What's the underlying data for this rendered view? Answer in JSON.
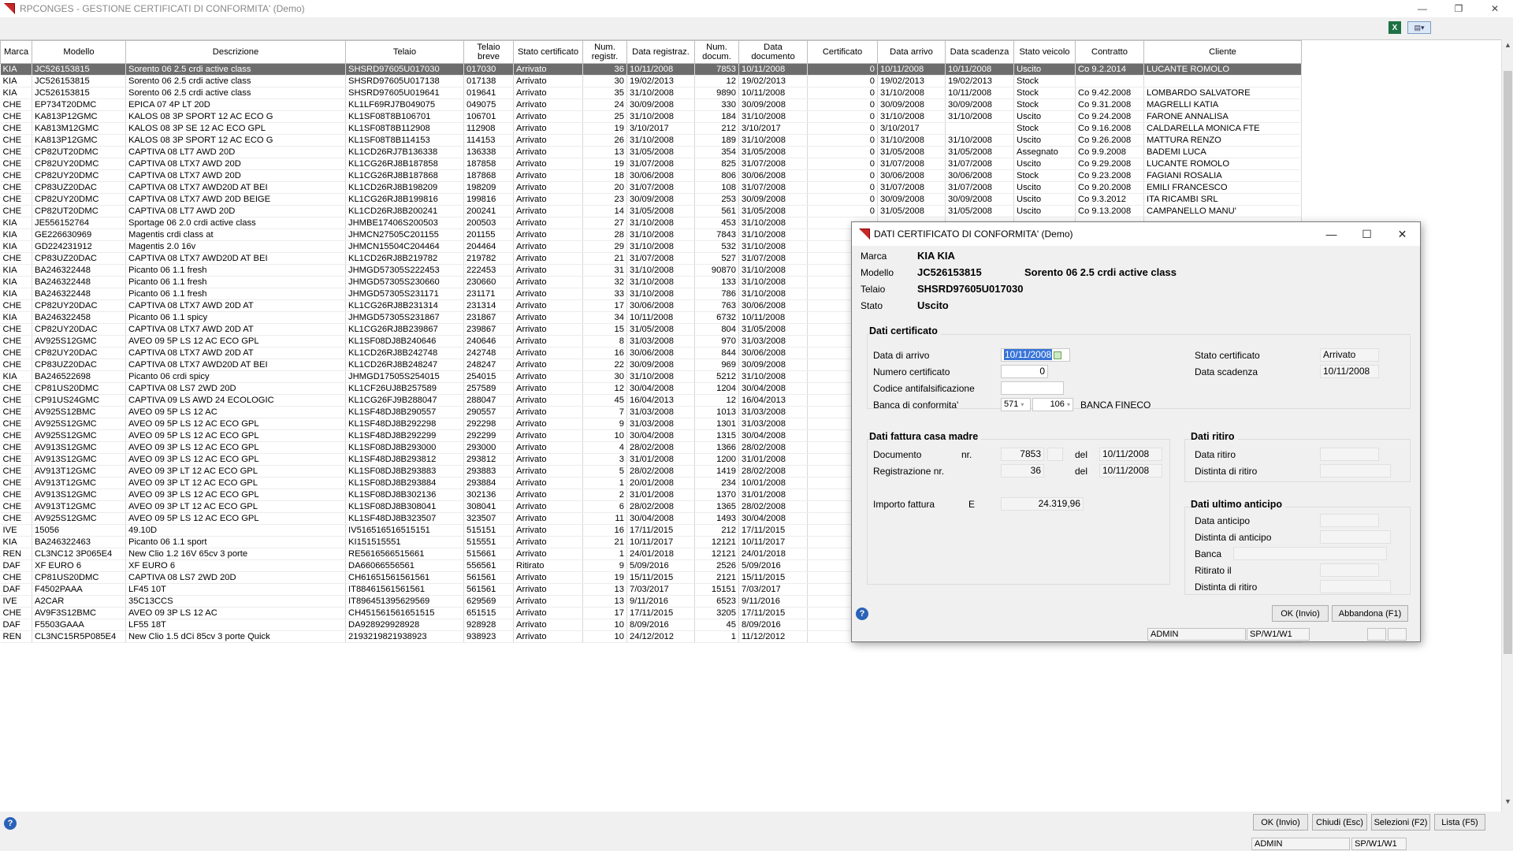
{
  "app": {
    "title": "RPCONGES - GESTIONE CERTIFICATI DI CONFORMITA'  (Demo)"
  },
  "window_controls": {
    "minimize": "—",
    "maximize": "❐",
    "close": "✕"
  },
  "toolbar": {
    "excel_icon": "X",
    "menu_icon": "▤▾"
  },
  "grid": {
    "columns": [
      "Marca",
      "Modello",
      "Descrizione",
      "Telaio",
      "Telaio breve",
      "Stato certificato",
      "Num. registr.",
      "Data registraz.",
      "Num. docum.",
      "Data documento",
      "Certificato",
      "Data arrivo",
      "Data scadenza",
      "Stato veicolo",
      "Contratto",
      "Cliente"
    ],
    "rows": [
      [
        "KIA",
        "JC526153815",
        "Sorento 06 2.5 crdi active class",
        "SHSRD97605U017030",
        "017030",
        "Arrivato",
        "36",
        "10/11/2008",
        "7853",
        "10/11/2008",
        "0",
        "10/11/2008",
        "10/11/2008",
        "Uscito",
        "Co 9.2.2014",
        "LUCANTE ROMOLO"
      ],
      [
        "KIA",
        "JC526153815",
        "Sorento 06 2.5 crdi active class",
        "SHSRD97605U017138",
        "017138",
        "Arrivato",
        "30",
        "19/02/2013",
        "12",
        "19/02/2013",
        "0",
        "19/02/2013",
        "19/02/2013",
        "Stock",
        "",
        ""
      ],
      [
        "KIA",
        "JC526153815",
        "Sorento 06 2.5 crdi active class",
        "SHSRD97605U019641",
        "019641",
        "Arrivato",
        "35",
        "31/10/2008",
        "9890",
        "10/11/2008",
        "0",
        "31/10/2008",
        "10/11/2008",
        "Stock",
        "Co 9.42.2008",
        "LOMBARDO SALVATORE"
      ],
      [
        "CHE",
        "EP734T20DMC",
        "EPICA 07 4P LT 20D",
        "KL1LF69RJ7B049075",
        "049075",
        "Arrivato",
        "24",
        "30/09/2008",
        "330",
        "30/09/2008",
        "0",
        "30/09/2008",
        "30/09/2008",
        "Stock",
        "Co 9.31.2008",
        "MAGRELLI KATIA"
      ],
      [
        "CHE",
        "KA813P12GMC",
        "KALOS 08 3P SPORT 12 AC ECO G",
        "KL1SF08T8B106701",
        "106701",
        "Arrivato",
        "25",
        "31/10/2008",
        "184",
        "31/10/2008",
        "0",
        "31/10/2008",
        "31/10/2008",
        "Uscito",
        "Co 9.24.2008",
        "FARONE ANNALISA"
      ],
      [
        "CHE",
        "KA813M12GMC",
        "KALOS 08 3P SE 12 AC ECO GPL",
        "KL1SF08T8B112908",
        "112908",
        "Arrivato",
        "19",
        "3/10/2017",
        "212",
        "3/10/2017",
        "0",
        "3/10/2017",
        "",
        "Stock",
        "Co 9.16.2008",
        "CALDARELLA MONICA FTE"
      ],
      [
        "CHE",
        "KA813P12GMC",
        "KALOS 08 3P SPORT 12 AC ECO G",
        "KL1SF08T8B114153",
        "114153",
        "Arrivato",
        "26",
        "31/10/2008",
        "189",
        "31/10/2008",
        "0",
        "31/10/2008",
        "31/10/2008",
        "Uscito",
        "Co 9.26.2008",
        "MATTURA RENZO"
      ],
      [
        "CHE",
        "CP82UT20DMC",
        "CAPTIVA 08 LT7 AWD 20D",
        "KL1CD26RJ7B136338",
        "136338",
        "Arrivato",
        "13",
        "31/05/2008",
        "354",
        "31/05/2008",
        "0",
        "31/05/2008",
        "31/05/2008",
        "Assegnato",
        "Co 9.9.2008",
        "BADEMI LUCA"
      ],
      [
        "CHE",
        "CP82UY20DMC",
        "CAPTIVA 08 LTX7 AWD 20D",
        "KL1CG26RJ8B187858",
        "187858",
        "Arrivato",
        "19",
        "31/07/2008",
        "825",
        "31/07/2008",
        "0",
        "31/07/2008",
        "31/07/2008",
        "Uscito",
        "Co 9.29.2008",
        "LUCANTE ROMOLO"
      ],
      [
        "CHE",
        "CP82UY20DMC",
        "CAPTIVA 08 LTX7 AWD 20D",
        "KL1CG26RJ8B187868",
        "187868",
        "Arrivato",
        "18",
        "30/06/2008",
        "806",
        "30/06/2008",
        "0",
        "30/06/2008",
        "30/06/2008",
        "Stock",
        "Co 9.23.2008",
        "FAGIANI ROSALIA"
      ],
      [
        "CHE",
        "CP83UZ20DAC",
        "CAPTIVA 08 LTX7 AWD20D AT BEI",
        "KL1CD26RJ8B198209",
        "198209",
        "Arrivato",
        "20",
        "31/07/2008",
        "108",
        "31/07/2008",
        "0",
        "31/07/2008",
        "31/07/2008",
        "Uscito",
        "Co 9.20.2008",
        "EMILI FRANCESCO"
      ],
      [
        "CHE",
        "CP82UY20DMC",
        "CAPTIVA 08 LTX7 AWD 20D BEIGE",
        "KL1CG26RJ8B199816",
        "199816",
        "Arrivato",
        "23",
        "30/09/2008",
        "253",
        "30/09/2008",
        "0",
        "30/09/2008",
        "30/09/2008",
        "Uscito",
        "Co 9.3.2012",
        "ITA RICAMBI SRL"
      ],
      [
        "CHE",
        "CP82UT20DMC",
        "CAPTIVA 08 LT7 AWD 20D",
        "KL1CD26RJ8B200241",
        "200241",
        "Arrivato",
        "14",
        "31/05/2008",
        "561",
        "31/05/2008",
        "0",
        "31/05/2008",
        "31/05/2008",
        "Uscito",
        "Co 9.13.2008",
        "CAMPANELLO MANU'"
      ],
      [
        "KIA",
        "JE556152764",
        "Sportage 06 2.0 crdi active class",
        "JHMBE17406S200503",
        "200503",
        "Arrivato",
        "27",
        "31/10/2008",
        "453",
        "31/10/2008",
        "",
        "",
        "",
        "",
        "",
        ""
      ],
      [
        "KIA",
        "GE226630969",
        "Magentis crdi class at",
        "JHMCN27505C201155",
        "201155",
        "Arrivato",
        "28",
        "31/10/2008",
        "7843",
        "31/10/2008",
        "",
        "",
        "",
        "",
        "",
        ""
      ],
      [
        "KIA",
        "GD224231912",
        "Magentis 2.0 16v",
        "JHMCN15504C204464",
        "204464",
        "Arrivato",
        "29",
        "31/10/2008",
        "532",
        "31/10/2008",
        "",
        "",
        "",
        "",
        "",
        ""
      ],
      [
        "CHE",
        "CP83UZ20DAC",
        "CAPTIVA 08 LTX7 AWD20D AT BEI",
        "KL1CD26RJ8B219782",
        "219782",
        "Arrivato",
        "21",
        "31/07/2008",
        "527",
        "31/07/2008",
        "",
        "",
        "",
        "",
        "",
        ""
      ],
      [
        "KIA",
        "BA246322448",
        "Picanto 06 1.1 fresh",
        "JHMGD57305S222453",
        "222453",
        "Arrivato",
        "31",
        "31/10/2008",
        "90870",
        "31/10/2008",
        "",
        "",
        "",
        "",
        "",
        ""
      ],
      [
        "KIA",
        "BA246322448",
        "Picanto 06 1.1 fresh",
        "JHMGD57305S230660",
        "230660",
        "Arrivato",
        "32",
        "31/10/2008",
        "133",
        "31/10/2008",
        "",
        "",
        "",
        "",
        "",
        ""
      ],
      [
        "KIA",
        "BA246322448",
        "Picanto 06 1.1 fresh",
        "JHMGD57305S231171",
        "231171",
        "Arrivato",
        "33",
        "31/10/2008",
        "786",
        "31/10/2008",
        "",
        "",
        "",
        "",
        "",
        ""
      ],
      [
        "CHE",
        "CP82UY20DAC",
        "CAPTIVA 08 LTX7 AWD 20D AT",
        "KL1CG26RJ8B231314",
        "231314",
        "Arrivato",
        "17",
        "30/06/2008",
        "763",
        "30/06/2008",
        "",
        "",
        "",
        "",
        "",
        ""
      ],
      [
        "KIA",
        "BA246322458",
        "Picanto 06 1.1 spicy",
        "JHMGD57305S231867",
        "231867",
        "Arrivato",
        "34",
        "10/11/2008",
        "6732",
        "10/11/2008",
        "",
        "",
        "",
        "",
        "",
        ""
      ],
      [
        "CHE",
        "CP82UY20DAC",
        "CAPTIVA 08 LTX7 AWD 20D AT",
        "KL1CG26RJ8B239867",
        "239867",
        "Arrivato",
        "15",
        "31/05/2008",
        "804",
        "31/05/2008",
        "",
        "",
        "",
        "",
        "",
        ""
      ],
      [
        "CHE",
        "AV925S12GMC",
        "AVEO 09 5P LS 12 AC ECO GPL",
        "KL1SF08DJ8B240646",
        "240646",
        "Arrivato",
        "8",
        "31/03/2008",
        "970",
        "31/03/2008",
        "",
        "",
        "",
        "",
        "",
        ""
      ],
      [
        "CHE",
        "CP82UY20DAC",
        "CAPTIVA 08 LTX7 AWD 20D AT",
        "KL1CD26RJ8B242748",
        "242748",
        "Arrivato",
        "16",
        "30/06/2008",
        "844",
        "30/06/2008",
        "",
        "",
        "",
        "",
        "",
        ""
      ],
      [
        "CHE",
        "CP83UZ20DAC",
        "CAPTIVA 08 LTX7 AWD20D AT BEI",
        "KL1CD26RJ8B248247",
        "248247",
        "Arrivato",
        "22",
        "30/09/2008",
        "969",
        "30/09/2008",
        "",
        "",
        "",
        "",
        "",
        ""
      ],
      [
        "KIA",
        "BA246522698",
        "Picanto 06 crdi spicy",
        "JHMGD17505S254015",
        "254015",
        "Arrivato",
        "30",
        "31/10/2008",
        "5212",
        "31/10/2008",
        "",
        "",
        "",
        "",
        "",
        ""
      ],
      [
        "CHE",
        "CP81US20DMC",
        "CAPTIVA 08 LS7 2WD 20D",
        "KL1CF26UJ8B257589",
        "257589",
        "Arrivato",
        "12",
        "30/04/2008",
        "1204",
        "30/04/2008",
        "",
        "",
        "",
        "",
        "",
        ""
      ],
      [
        "CHE",
        "CP91US24GMC",
        "CAPTIVA 09 LS AWD 24 ECOLOGIC",
        "KL1CG26FJ9B288047",
        "288047",
        "Arrivato",
        "45",
        "16/04/2013",
        "12",
        "16/04/2013",
        "",
        "",
        "",
        "",
        "",
        ""
      ],
      [
        "CHE",
        "AV925S12BMC",
        "AVEO 09 5P LS 12 AC",
        "KL1SF48DJ8B290557",
        "290557",
        "Arrivato",
        "7",
        "31/03/2008",
        "1013",
        "31/03/2008",
        "",
        "",
        "",
        "",
        "",
        ""
      ],
      [
        "CHE",
        "AV925S12GMC",
        "AVEO 09 5P LS 12 AC ECO GPL",
        "KL1SF48DJ8B292298",
        "292298",
        "Arrivato",
        "9",
        "31/03/2008",
        "1301",
        "31/03/2008",
        "",
        "",
        "",
        "",
        "",
        ""
      ],
      [
        "CHE",
        "AV925S12GMC",
        "AVEO 09 5P LS 12 AC ECO GPL",
        "KL1SF48DJ8B292299",
        "292299",
        "Arrivato",
        "10",
        "30/04/2008",
        "1315",
        "30/04/2008",
        "",
        "",
        "",
        "",
        "",
        ""
      ],
      [
        "CHE",
        "AV913S12GMC",
        "AVEO 09 3P LS 12 AC ECO GPL",
        "KL1SF08DJ8B293000",
        "293000",
        "Arrivato",
        "4",
        "28/02/2008",
        "1366",
        "28/02/2008",
        "",
        "",
        "",
        "",
        "",
        ""
      ],
      [
        "CHE",
        "AV913S12GMC",
        "AVEO 09 3P LS 12 AC ECO GPL",
        "KL1SF48DJ8B293812",
        "293812",
        "Arrivato",
        "3",
        "31/01/2008",
        "1200",
        "31/01/2008",
        "",
        "",
        "",
        "",
        "",
        ""
      ],
      [
        "CHE",
        "AV913T12GMC",
        "AVEO 09 3P LT 12 AC ECO GPL",
        "KL1SF08DJ8B293883",
        "293883",
        "Arrivato",
        "5",
        "28/02/2008",
        "1419",
        "28/02/2008",
        "",
        "",
        "",
        "",
        "",
        ""
      ],
      [
        "CHE",
        "AV913T12GMC",
        "AVEO 09 3P LT 12 AC ECO GPL",
        "KL1SF08DJ8B293884",
        "293884",
        "Arrivato",
        "1",
        "20/01/2008",
        "234",
        "10/01/2008",
        "",
        "",
        "",
        "",
        "",
        ""
      ],
      [
        "CHE",
        "AV913S12GMC",
        "AVEO 09 3P LS 12 AC ECO GPL",
        "KL1SF08DJ8B302136",
        "302136",
        "Arrivato",
        "2",
        "31/01/2008",
        "1370",
        "31/01/2008",
        "",
        "",
        "",
        "",
        "",
        ""
      ],
      [
        "CHE",
        "AV913T12GMC",
        "AVEO 09 3P LT 12 AC ECO GPL",
        "KL1SF08DJ8B308041",
        "308041",
        "Arrivato",
        "6",
        "28/02/2008",
        "1365",
        "28/02/2008",
        "",
        "",
        "",
        "",
        "",
        ""
      ],
      [
        "CHE",
        "AV925S12GMC",
        "AVEO 09 5P LS 12 AC ECO GPL",
        "KL1SF48DJ8B323507",
        "323507",
        "Arrivato",
        "11",
        "30/04/2008",
        "1493",
        "30/04/2008",
        "",
        "",
        "",
        "",
        "",
        ""
      ],
      [
        "IVE",
        "15056",
        "49.10D",
        "IV516516516515151",
        "515151",
        "Arrivato",
        "16",
        "17/11/2015",
        "212",
        "17/11/2015",
        "",
        "",
        "",
        "",
        "",
        ""
      ],
      [
        "KIA",
        "BA246322463",
        "Picanto 06 1.1 sport",
        "KI151515551",
        "515551",
        "Arrivato",
        "21",
        "10/11/2017",
        "12121",
        "10/11/2017",
        "",
        "",
        "",
        "",
        "",
        ""
      ],
      [
        "REN",
        "CL3NC12 3P065E4",
        "New Clio 1.2 16V 65cv 3 porte",
        "RE5616566515661",
        "515661",
        "Arrivato",
        "1",
        "24/01/2018",
        "12121",
        "24/01/2018",
        "",
        "",
        "",
        "",
        "",
        ""
      ],
      [
        "DAF",
        "XF EURO 6",
        "XF EURO 6",
        "DA66066556561",
        "556561",
        "Ritirato",
        "9",
        "5/09/2016",
        "2526",
        "5/09/2016",
        "",
        "",
        "",
        "",
        "",
        ""
      ],
      [
        "CHE",
        "CP81US20DMC",
        "CAPTIVA 08 LS7 2WD 20D",
        "CH61651561561561",
        "561561",
        "Arrivato",
        "19",
        "15/11/2015",
        "2121",
        "15/11/2015",
        "",
        "",
        "",
        "",
        "",
        ""
      ],
      [
        "DAF",
        "F4502PAAA",
        "LF45 10T",
        "IT88461561561561",
        "561561",
        "Arrivato",
        "13",
        "7/03/2017",
        "15151",
        "7/03/2017",
        "",
        "",
        "",
        "",
        "",
        ""
      ],
      [
        "IVE",
        "A2CAR",
        "35C13CCS",
        "IT896451395629569",
        "629569",
        "Arrivato",
        "13",
        "9/11/2016",
        "6523",
        "9/11/2016",
        "",
        "",
        "",
        "",
        "",
        ""
      ],
      [
        "CHE",
        "AV9F3S12BMC",
        "AVEO 09 3P LS 12 AC",
        "CH451561561651515",
        "651515",
        "Arrivato",
        "17",
        "17/11/2015",
        "3205",
        "17/11/2015",
        "",
        "",
        "",
        "",
        "",
        ""
      ],
      [
        "DAF",
        "F5503GAAA",
        "LF55 18T",
        "DA928929928928",
        "928928",
        "Arrivato",
        "10",
        "8/09/2016",
        "45",
        "8/09/2016",
        "",
        "",
        "",
        "",
        "",
        ""
      ],
      [
        "REN",
        "CL3NC15R5P085E4",
        "New Clio 1.5 dCi 85cv 3 porte Quick",
        "2193219821938923",
        "938923",
        "Arrivato",
        "10",
        "24/12/2012",
        "1",
        "11/12/2012",
        "",
        "",
        "",
        "",
        "",
        ""
      ]
    ]
  },
  "bottom": {
    "ok": "OK (Invio)",
    "chiudi": "Chiudi (Esc)",
    "selezioni": "Selezioni (F2)",
    "lista": "Lista (F5)",
    "user": "ADMIN",
    "path": "SP/W1/W1"
  },
  "dialog": {
    "title": "DATI CERTIFICATO DI CONFORMITA'  (Demo)",
    "marca_label": "Marca",
    "marca": "KIA  KIA",
    "modello_label": "Modello",
    "modello": "JC526153815",
    "modello_desc": "Sorento 06 2.5 crdi active class",
    "telaio_label": "Telaio",
    "telaio": "SHSRD97605U017030",
    "stato_label": "Stato",
    "stato": "Uscito",
    "cert_group": "Dati certificato",
    "data_arrivo_label": "Data di arrivo",
    "data_arrivo": "10/11/2008",
    "numero_cert_label": "Numero certificato",
    "numero_cert": "0",
    "codice_label": "Codice antifalsificazione",
    "codice": "",
    "banca_label": "Banca di conformita'",
    "banca_abi": "571",
    "banca_cab": "106",
    "banca_name": "BANCA FINECO",
    "stato_cert_label": "Stato certificato",
    "stato_cert": "Arrivato",
    "data_scad_label": "Data scadenza",
    "data_scad": "10/11/2008",
    "fattura_group": "Dati fattura casa madre",
    "documento_label": "Documento",
    "nr_label": "nr.",
    "documento_nr": "7853",
    "del_label": "del",
    "documento_del": "10/11/2008",
    "registrazione_label": "Registrazione nr.",
    "registrazione_nr": "36",
    "registrazione_del": "10/11/2008",
    "importo_label": "Importo fattura",
    "currency": "E",
    "importo": "24.319,96",
    "ritiro_group": "Dati ritiro",
    "data_ritiro_label": "Data ritiro",
    "distinta_ritiro_label": "Distinta di ritiro",
    "anticipo_group": "Dati ultimo anticipo",
    "data_anticipo_label": "Data anticipo",
    "distinta_anticipo_label": "Distinta di anticipo",
    "banca2_label": "Banca",
    "ritirato_label": "Ritirato il",
    "distinta_ritiro2_label": "Distinta di ritiro",
    "ok": "OK (Invio)",
    "abbandona": "Abbandona (F1)",
    "user": "ADMIN",
    "path": "SP/W1/W1"
  }
}
